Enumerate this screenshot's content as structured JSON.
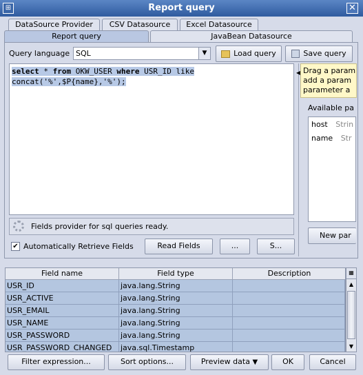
{
  "window": {
    "title": "Report query",
    "icon": "app-icon",
    "close": "✕"
  },
  "tabs_row1": [
    "DataSource Provider",
    "CSV Datasource",
    "Excel Datasource"
  ],
  "tabs_row2": [
    "Report query",
    "JavaBean Datasource"
  ],
  "query": {
    "language_label": "Query language",
    "language_value": "SQL",
    "load_label": "Load query",
    "save_label": "Save query",
    "text_line1_kw1": "select",
    "text_line1_a": " * ",
    "text_line1_kw2": "from",
    "text_line1_b": " OKW_USER ",
    "text_line1_kw3": "where",
    "text_line1_c": " USR_ID like",
    "text_line2": "concat('%',$P{name},'%');"
  },
  "params": {
    "hint_line1": "Drag a param",
    "hint_line2": "add a param",
    "hint_line3": "parameter a",
    "available_label": "Available pa",
    "items": [
      {
        "name": "host",
        "type": "Strin"
      },
      {
        "name": "name",
        "type": "Str"
      }
    ],
    "new_label": "New par"
  },
  "status": {
    "text": "Fields provider for sql queries ready."
  },
  "auto_retrieve": {
    "label": "Automatically Retrieve Fields",
    "checked": true
  },
  "buttons": {
    "read_fields": "Read Fields",
    "ellipsis": "...",
    "s": "S..."
  },
  "table": {
    "headers": [
      "Field name",
      "Field type",
      "Description"
    ],
    "rows": [
      {
        "name": "USR_ID",
        "type": "java.lang.String",
        "desc": ""
      },
      {
        "name": "USR_ACTIVE",
        "type": "java.lang.String",
        "desc": ""
      },
      {
        "name": "USR_EMAIL",
        "type": "java.lang.String",
        "desc": ""
      },
      {
        "name": "USR_NAME",
        "type": "java.lang.String",
        "desc": ""
      },
      {
        "name": "USR_PASSWORD",
        "type": "java.lang.String",
        "desc": ""
      },
      {
        "name": "USR_PASSWORD_CHANGED",
        "type": "java.sql.Timestamp",
        "desc": ""
      }
    ]
  },
  "bottom": {
    "filter": "Filter expression...",
    "sort": "Sort options...",
    "preview": "Preview data",
    "ok": "OK",
    "cancel": "Cancel"
  }
}
